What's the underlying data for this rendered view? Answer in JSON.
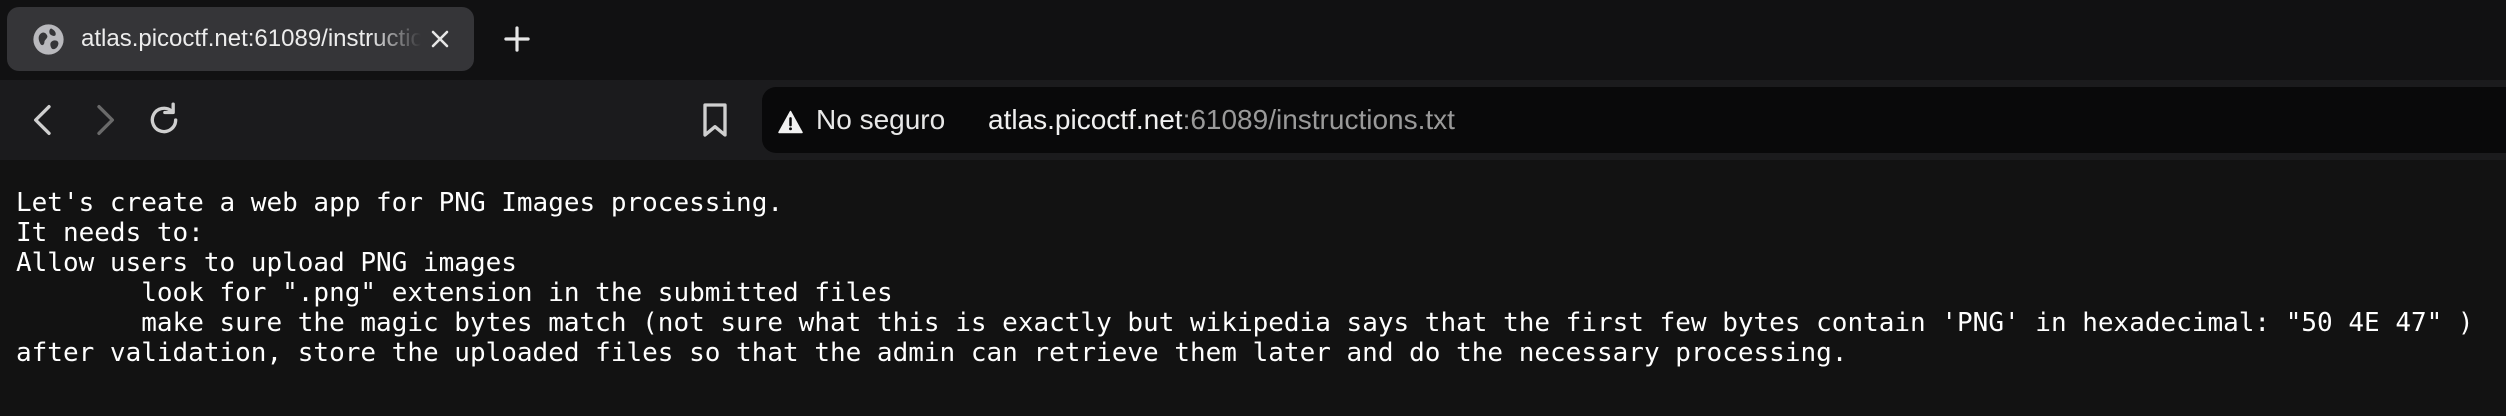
{
  "tab": {
    "title": "atlas.picoctf.net:61089/instructions.txt",
    "favicon": "globe-icon",
    "close_icon": "close-icon"
  },
  "new_tab_icon": "plus-icon",
  "toolbar": {
    "back_icon": "chevron-left-icon",
    "forward_icon": "chevron-right-icon",
    "reload_icon": "reload-icon",
    "bookmark_icon": "bookmark-icon"
  },
  "address_bar": {
    "security_icon": "warning-triangle-icon",
    "security_label": "No seguro",
    "url_host": "atlas.picoctf.net",
    "url_rest": ":61089/instructions.txt"
  },
  "document": {
    "lines": [
      "Let's create a web app for PNG Images processing.",
      "It needs to:",
      "Allow users to upload PNG images",
      "\tlook for \".png\" extension in the submitted files",
      "\tmake sure the magic bytes match (not sure what this is exactly but wikipedia says that the first few bytes contain 'PNG' in hexadecimal: \"50 4E 47\" )",
      "after validation, store the uploaded files so that the admin can retrieve them later and do the necessary processing."
    ]
  },
  "colors": {
    "tabstrip_bg": "#111112",
    "active_tab_bg": "#353538",
    "toolbar_bg": "#1b1b1d",
    "omnibox_bg": "#09090a",
    "content_bg": "#121212",
    "text": "#ffffff",
    "url_path": "#9a9a9a"
  }
}
